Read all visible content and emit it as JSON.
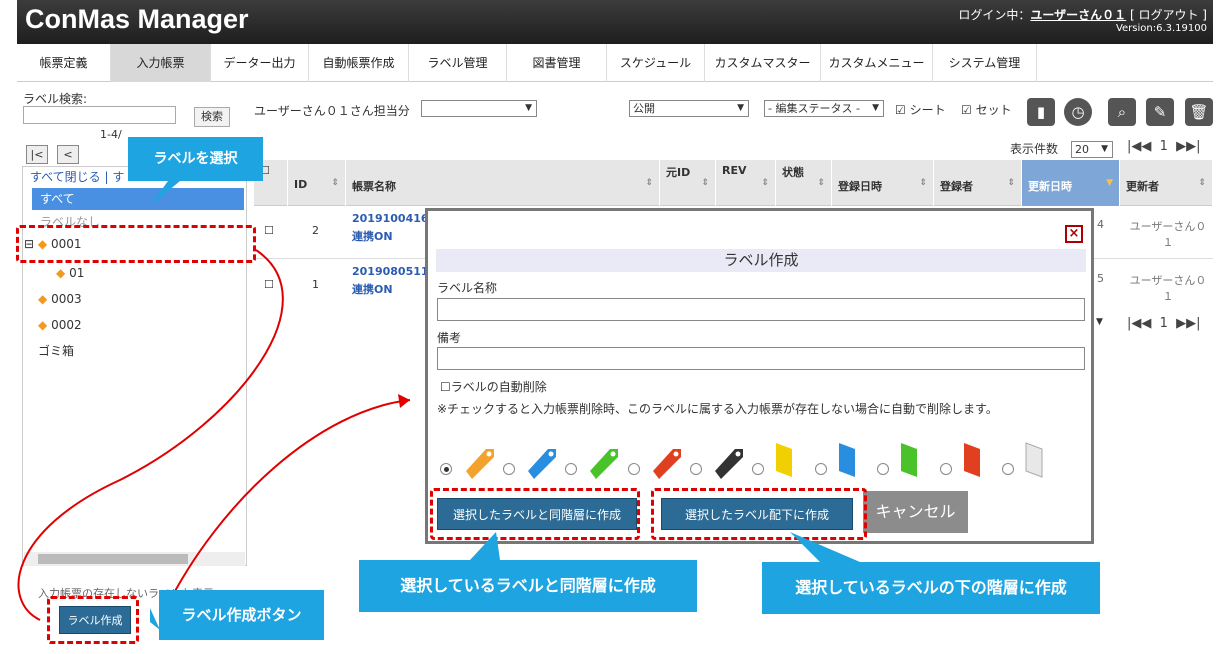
{
  "header": {
    "logo": "ConMas Manager",
    "login_prefix": "ログイン中：",
    "user": "ユーザーさん０１",
    "logout": "[ ログアウト ]",
    "version": "Version:6.3.19100"
  },
  "nav": [
    {
      "label": "帳票定義"
    },
    {
      "label": "入力帳票"
    },
    {
      "label": "データー出力"
    },
    {
      "label": "自動帳票作成"
    },
    {
      "label": "ラベル管理"
    },
    {
      "label": "図書管理"
    },
    {
      "label": "スケジュール"
    },
    {
      "label": "カスタムマスター"
    },
    {
      "label": "カスタムメニュー"
    },
    {
      "label": "システム管理"
    }
  ],
  "toolbar": {
    "label_search": "ラベル検索:",
    "search_btn": "検索",
    "user_filter": "ユーザーさん０１さん担当分",
    "publish": "公開",
    "edit_status": "- 編集ステータス -",
    "sheet": "シート",
    "set": "セット",
    "count": "1-4/",
    "per_page_label": "表示件数",
    "per_page": "20",
    "page": "1"
  },
  "tree": {
    "close_all": "すべて閉じる | す",
    "all": "すべて",
    "no_label": "ラベルなし",
    "items": [
      "0001",
      "01",
      "0003",
      "0002",
      "ゴミ箱"
    ]
  },
  "bottom_text": "入力帳票の存在しないラベルも表示",
  "create_btn": "ラベル作成",
  "table": {
    "headers": [
      "ID",
      "帳票名称",
      "元ID",
      "REV",
      "状態",
      "登録日時",
      "登録者",
      "更新日時",
      "更新者"
    ],
    "rows": [
      {
        "id": "2",
        "name": "2019100416",
        "name2": "連携ON",
        "updater": "ユーザーさん０１",
        "n": "4"
      },
      {
        "id": "1",
        "name": "2019080511",
        "name2": "連携ON",
        "updater": "ユーザーさん０１",
        "n": "5"
      }
    ]
  },
  "dialog": {
    "title": "ラベル作成",
    "name_label": "ラベル名称",
    "note_label": "備考",
    "auto_delete": "ラベルの自動削除",
    "auto_delete_note": "※チェックすると入力帳票削除時、このラベルに属する入力帳票が存在しない場合に自動で削除します。",
    "btn_same": "選択したラベルと同階層に作成",
    "btn_child": "選択したラベル配下に作成",
    "btn_cancel": "キャンセル",
    "close": "×"
  },
  "callouts": {
    "select": "ラベルを選択",
    "create": "ラベル作成ボタン",
    "same": "選択しているラベルと同階層に作成",
    "child": "選択しているラベルの下の階層に作成"
  },
  "colors": {
    "accent": "#1ea4e0",
    "button": "#2c6b95",
    "dashed": "#e00000"
  }
}
